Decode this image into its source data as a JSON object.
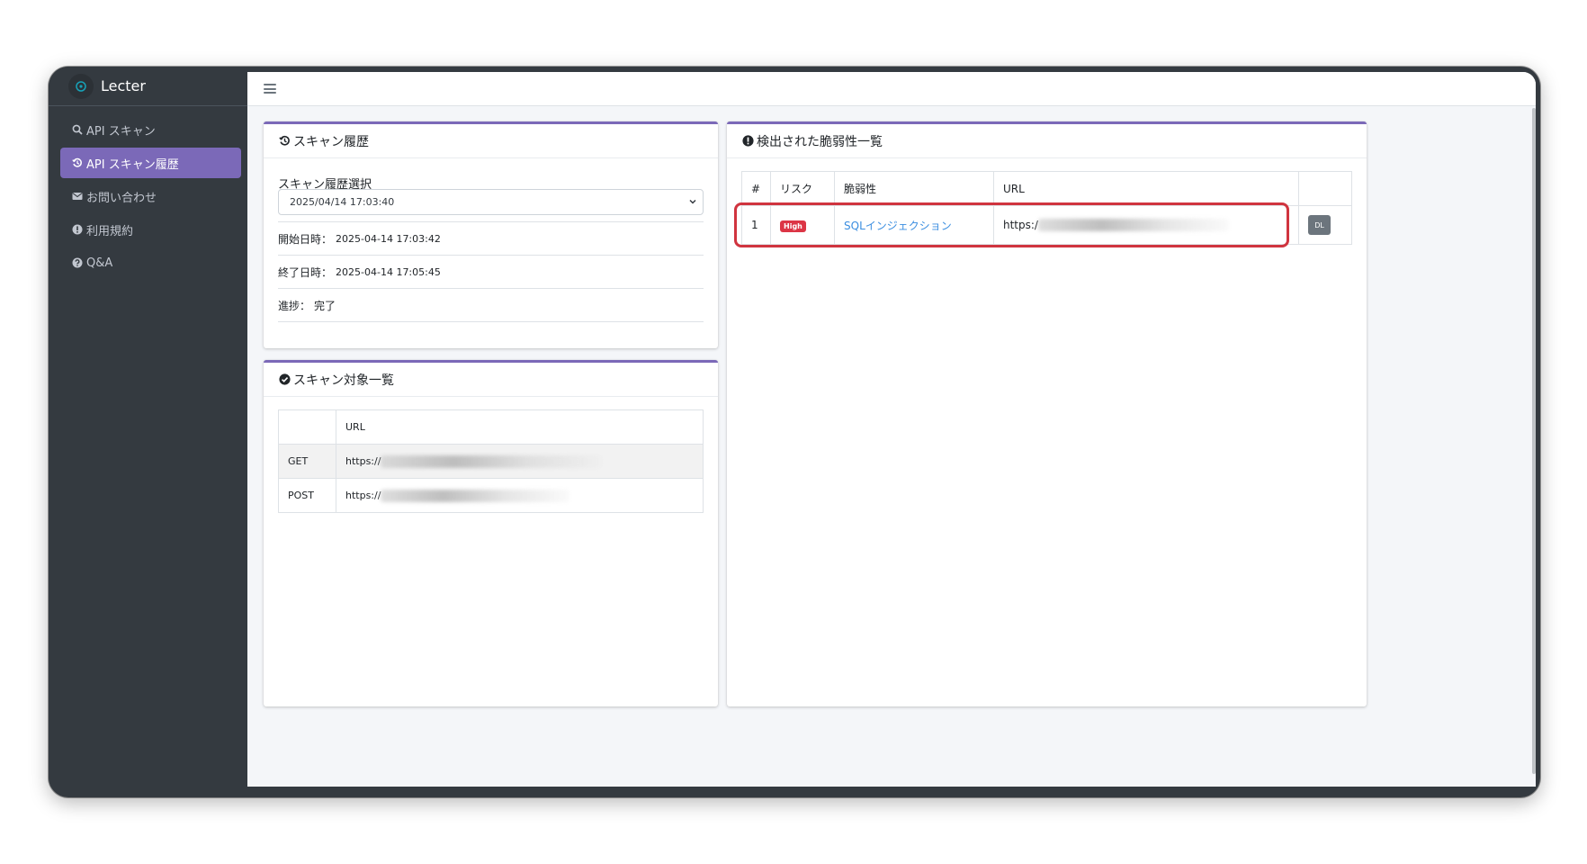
{
  "app": {
    "brand": "Lecter",
    "logo_icon": "lecter-logo-icon"
  },
  "sidebar": {
    "items": [
      {
        "label": "API スキャン",
        "icon": "search-icon",
        "active": false
      },
      {
        "label": "API スキャン履歴",
        "icon": "history-icon",
        "active": true
      },
      {
        "label": "お問い合わせ",
        "icon": "envelope-icon",
        "active": false
      },
      {
        "label": "利用規約",
        "icon": "info-icon",
        "active": false
      },
      {
        "label": "Q&A",
        "icon": "question-icon",
        "active": false
      }
    ]
  },
  "history_card": {
    "title": "スキャン履歴",
    "select_label": "スキャン履歴選択",
    "select_value": "2025/04/14 17:03:40",
    "start_label": "開始日時：",
    "start_value": "2025-04-14 17:03:42",
    "end_label": "終了日時：",
    "end_value": "2025-04-14 17:05:45",
    "progress_label": "進捗：",
    "progress_value": "完了"
  },
  "targets_card": {
    "title": "スキャン対象一覧",
    "columns": [
      "",
      "URL"
    ],
    "rows": [
      {
        "method": "GET",
        "url": "https://"
      },
      {
        "method": "POST",
        "url": "https://"
      }
    ]
  },
  "vulns_card": {
    "title": "検出された脆弱性一覧",
    "columns": [
      "#",
      "リスク",
      "脆弱性",
      "URL",
      ""
    ],
    "rows": [
      {
        "index": "1",
        "risk": "High",
        "name": "SQLインジェクション",
        "url": "https:/",
        "action": "DL"
      }
    ]
  },
  "colors": {
    "accent": "#7b69b8",
    "sidebar_bg": "#343a40",
    "danger": "#dc3545",
    "link": "#3b8ee0",
    "highlight": "#d0343f"
  }
}
